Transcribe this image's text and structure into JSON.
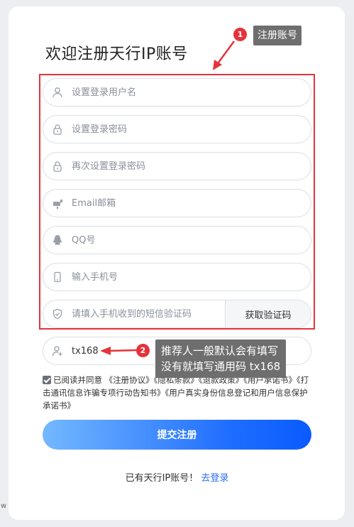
{
  "page": {
    "title": "欢迎注册天行IP账号"
  },
  "form": {
    "username_placeholder": "设置登录用户名",
    "password_placeholder": "设置登录密码",
    "confirm_password_placeholder": "再次设置登录密码",
    "email_placeholder": "Email邮箱",
    "qq_placeholder": "QQ号",
    "phone_placeholder": "输入手机号",
    "sms_placeholder": "请填入手机收到的短信验证码",
    "sms_button": "获取验证码",
    "referrer_value": "tx168"
  },
  "agreement": {
    "checked": true,
    "prefix": "已阅读并同意",
    "links": [
      "《注册协议》",
      "《隐私条款》",
      "《退款政策》",
      "《用户承诺书》",
      "《打击通讯信息诈骗专项行动告知书》",
      "《用户真实身份信息登记和用户信息保护承诺书》"
    ]
  },
  "submit_label": "提交注册",
  "login": {
    "text": "已有天行IP账号！",
    "link": "去登录"
  },
  "annotations": {
    "badge1": "1",
    "tip1": "注册账号",
    "badge2": "2",
    "tip2_line1": "推荐人一般默认会有填写",
    "tip2_line2": "没有就填写通用码 tx168",
    "color": "#e5333b"
  },
  "edge_text": "w",
  "colors": {
    "accent": "#1f6dff",
    "link": "#2a6ef5",
    "annotation_red": "#e5333b",
    "tooltip_bg": "#6e6e6e"
  }
}
